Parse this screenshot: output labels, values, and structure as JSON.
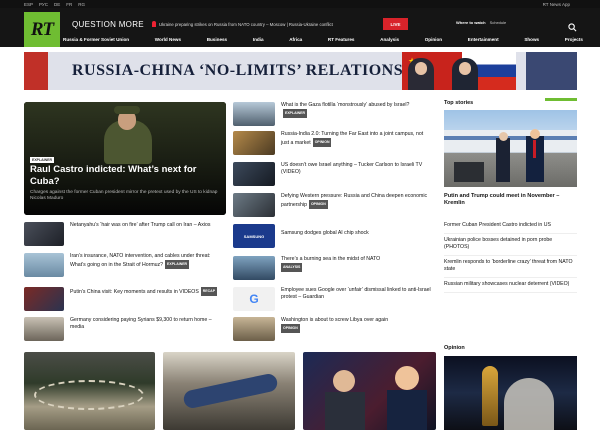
{
  "topbar": {
    "left_items": [
      "ESP",
      "РУС",
      "DE",
      "FR",
      "RG"
    ],
    "right_items": [
      "RT News App"
    ]
  },
  "header": {
    "logo_text": "RT",
    "question_more": "QUESTION MORE",
    "ticker": "Ukraine preparing strikes on Russia from NATO country – Moscow | Russia-Ukraine conflict",
    "live_label": "LIVE",
    "where_to_watch": "Where to watch",
    "schedule": "Schedule"
  },
  "nav": [
    "Russia & Former Soviet Union",
    "World News",
    "Business",
    "India",
    "Africa",
    "RT Features",
    "Analysis",
    "Opinion",
    "Entertainment",
    "Shows",
    "Projects"
  ],
  "banner": {
    "title": "RUSSIA-CHINA ‘NO-LIMITS’ RELATIONSHIP"
  },
  "hero": {
    "tag": "EXPLAINER",
    "headline": "Raul Castro indicted: What’s next for Cuba?",
    "sub": "Charges against the former Cuban president mirror the pretext used by the US to kidnap Nicolas Maduro"
  },
  "left_list": [
    {
      "text": "Netanyahu’s ‘hair was on fire’ after Trump call on Iran – Axios",
      "tag": ""
    },
    {
      "text": "Iran’s insurance, NATO intervention, and cables under threat: What’s going on in the Strait of Hormuz?",
      "tag": "EXPLAINER"
    },
    {
      "text": "Putin’s China visit: Key moments and results in VIDEOS",
      "tag": "RECAP"
    },
    {
      "text": "Germany considering paying Syrians $9,300 to return home – media",
      "tag": ""
    }
  ],
  "mid_list": [
    {
      "text": "What is the Gaza flotilla ‘monstrously’ abused by Israel?",
      "tag": "EXPLAINER"
    },
    {
      "text": "Russia-India 2.0: Turning the Far East into a joint campus, not just a market",
      "tag": "OPINION"
    },
    {
      "text": "US doesn’t owe Israel anything – Tucker Carlson to Israeli TV (VIDEO)",
      "tag": ""
    },
    {
      "text": "Defying Western pressure: Russia and China deepen economic partnership",
      "tag": "OPINION"
    },
    {
      "text": "Samsung dodges global AI chip shock",
      "tag": ""
    },
    {
      "text": "There’s a burning sea in the midst of NATO",
      "tag": "ANALYSIS"
    },
    {
      "text": "Employee sues Google over ‘unfair’ dismissal linked to anti-Israel protest – Guardian",
      "tag": ""
    },
    {
      "text": "Washington is about to screw Libya over again",
      "tag": "OPINION"
    }
  ],
  "top_stories": {
    "title": "Top stories",
    "main": "Putin and Trump could meet in November – Kremlin",
    "items": [
      "Former Cuban President Castro indicted in US",
      "Ukrainian police bosses detained in porn probe (PHOTOS)",
      "Kremlin responds to ‘borderline crazy’ threat from NATO state",
      "Russian military showcases nuclear deterrent (VIDEO)"
    ]
  },
  "opinion": {
    "title": "Opinion"
  },
  "thumb_labels": {
    "samsung": "SAMSUNG",
    "google": "G"
  }
}
